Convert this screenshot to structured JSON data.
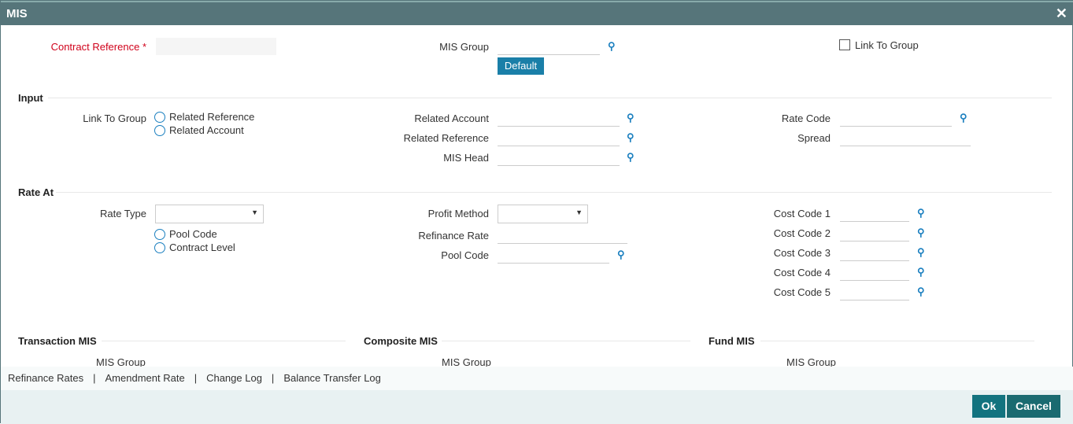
{
  "window": {
    "title": "MIS",
    "close": "✕"
  },
  "top": {
    "contract_reference": "Contract Reference",
    "required": "*",
    "mis_group": "MIS Group",
    "default": "Default",
    "link_to_group": "Link To Group"
  },
  "input": {
    "title": "Input",
    "link_to_group": "Link To Group",
    "related_reference_opt": "Related Reference",
    "related_account_opt": "Related Account",
    "related_account": "Related Account",
    "related_reference": "Related Reference",
    "mis_head": "MIS Head",
    "rate_code": "Rate Code",
    "spread": "Spread"
  },
  "rate_at": {
    "title": "Rate At",
    "rate_type": "Rate Type",
    "pool_code_opt": "Pool Code",
    "contract_level_opt": "Contract Level",
    "profit_method": "Profit Method",
    "refinance_rate": "Refinance Rate",
    "pool_code": "Pool Code",
    "cost_codes": [
      "Cost Code 1",
      "Cost Code 2",
      "Cost Code 3",
      "Cost Code 4",
      "Cost Code 5"
    ]
  },
  "sections": {
    "transaction": "Transaction MIS",
    "composite": "Composite MIS",
    "fund": "Fund MIS",
    "mis_group": "MIS Group"
  },
  "links": [
    "Refinance Rates",
    "Amendment Rate",
    "Change Log",
    "Balance Transfer Log"
  ],
  "footer": {
    "ok": "Ok",
    "cancel": "Cancel"
  }
}
